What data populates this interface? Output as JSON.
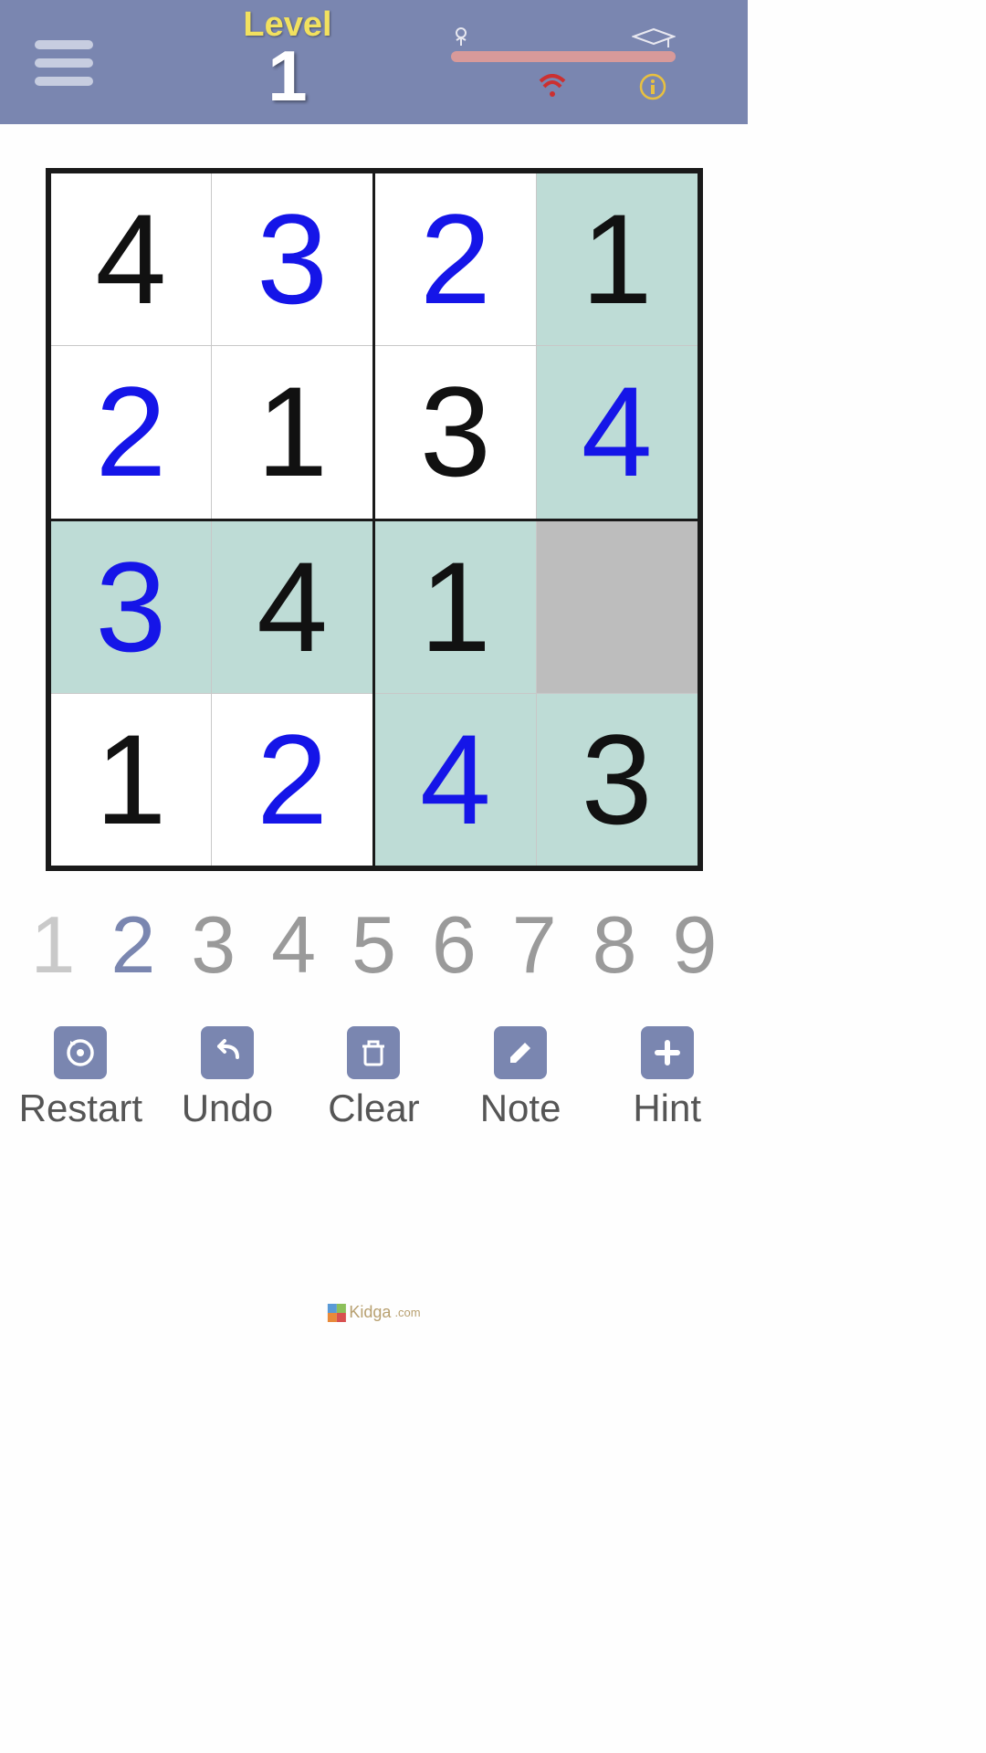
{
  "header": {
    "level_label": "Level",
    "level_number": "1"
  },
  "grid": {
    "cells": [
      {
        "v": "4",
        "t": "given",
        "hl": false,
        "sel": false
      },
      {
        "v": "3",
        "t": "user",
        "hl": false,
        "sel": false
      },
      {
        "v": "2",
        "t": "user",
        "hl": false,
        "sel": false
      },
      {
        "v": "1",
        "t": "given",
        "hl": true,
        "sel": false
      },
      {
        "v": "2",
        "t": "user",
        "hl": false,
        "sel": false
      },
      {
        "v": "1",
        "t": "given",
        "hl": false,
        "sel": false
      },
      {
        "v": "3",
        "t": "given",
        "hl": false,
        "sel": false
      },
      {
        "v": "4",
        "t": "user",
        "hl": true,
        "sel": false
      },
      {
        "v": "3",
        "t": "user",
        "hl": true,
        "sel": false
      },
      {
        "v": "4",
        "t": "given",
        "hl": true,
        "sel": false
      },
      {
        "v": "1",
        "t": "given",
        "hl": true,
        "sel": false
      },
      {
        "v": "",
        "t": "given",
        "hl": false,
        "sel": true
      },
      {
        "v": "1",
        "t": "given",
        "hl": false,
        "sel": false
      },
      {
        "v": "2",
        "t": "user",
        "hl": false,
        "sel": false
      },
      {
        "v": "4",
        "t": "user",
        "hl": true,
        "sel": false
      },
      {
        "v": "3",
        "t": "given",
        "hl": true,
        "sel": false
      }
    ]
  },
  "numpad": [
    {
      "n": "1",
      "state": "dim"
    },
    {
      "n": "2",
      "state": "active"
    },
    {
      "n": "3",
      "state": "normal"
    },
    {
      "n": "4",
      "state": "normal"
    },
    {
      "n": "5",
      "state": "normal"
    },
    {
      "n": "6",
      "state": "normal"
    },
    {
      "n": "7",
      "state": "normal"
    },
    {
      "n": "8",
      "state": "normal"
    },
    {
      "n": "9",
      "state": "normal"
    }
  ],
  "toolbar": {
    "restart": "Restart",
    "undo": "Undo",
    "clear": "Clear",
    "note": "Note",
    "hint": "Hint"
  },
  "footer": {
    "brand": "Kidga",
    "tld": ".com"
  }
}
